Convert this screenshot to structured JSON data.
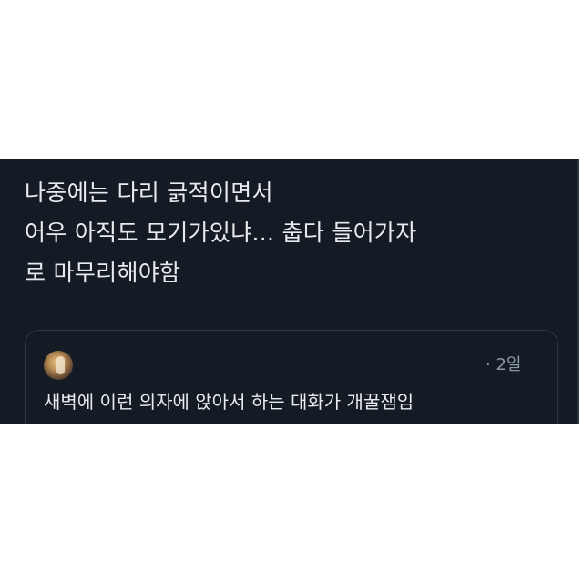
{
  "tweet": {
    "lines": [
      "나중에는 다리 긁적이면서",
      "어우 아직도 모기가있냐... 춥다 들어가자",
      "로 마무리해야함"
    ]
  },
  "quote": {
    "timestamp": "· 2일",
    "text": "새벽에 이런 의자에 앉아서 하는 대화가 개꿀잼임"
  },
  "colors": {
    "background": "#151b25",
    "text": "#e8eaed",
    "muted": "#8b98a5",
    "border": "#2f3640"
  }
}
